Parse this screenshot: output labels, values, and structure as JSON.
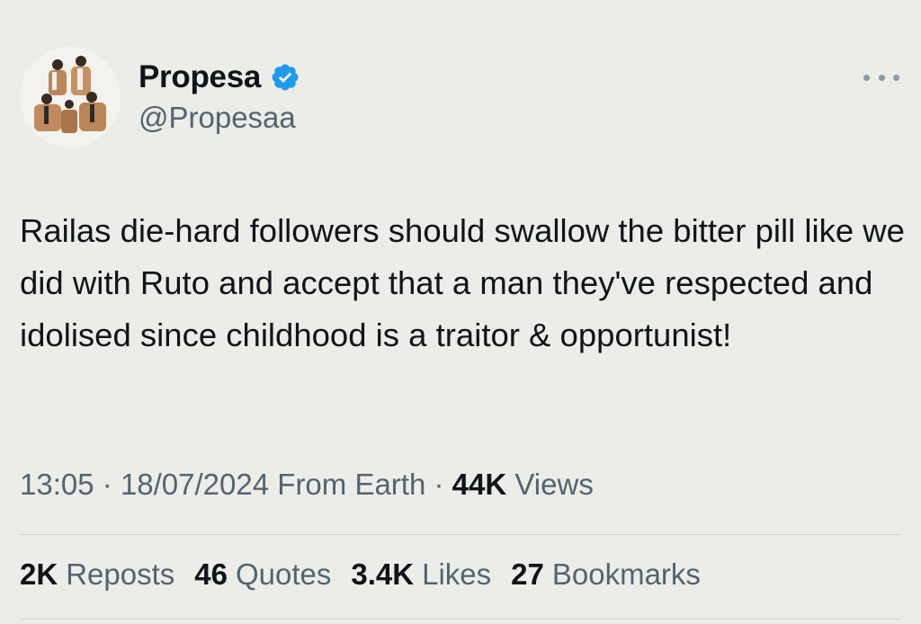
{
  "tweet": {
    "author": {
      "display_name": "Propesa",
      "handle": "@Propesaa",
      "verified": true,
      "avatar_icon": "group-photo-avatar"
    },
    "more_icon": "more-horizontal-icon",
    "text": "Railas die-hard followers should swallow the bitter pill like we did with Ruto and accept that a man they've respected and idolised since childhood is a traitor & opportunist!",
    "meta": {
      "time": "13:05",
      "separator": "·",
      "date": "18/07/2024",
      "source": "From Earth",
      "views_count": "44K",
      "views_label": "Views"
    },
    "stats": [
      {
        "count": "2K",
        "label": "Reposts"
      },
      {
        "count": "46",
        "label": "Quotes"
      },
      {
        "count": "3.4K",
        "label": "Likes"
      },
      {
        "count": "27",
        "label": "Bookmarks"
      }
    ]
  },
  "colors": {
    "background": "#ecede8",
    "text": "#0f1419",
    "secondary": "#536471",
    "verified": "#1d9bf0"
  }
}
